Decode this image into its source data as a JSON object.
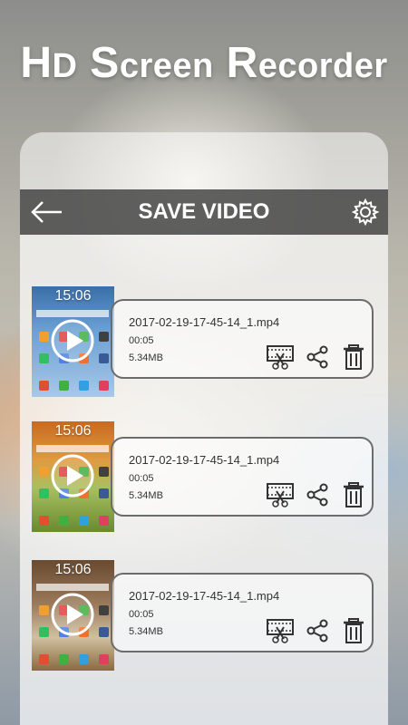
{
  "header": {
    "title_parts": [
      "H",
      "D",
      " S",
      "creen",
      " R",
      "ecorder"
    ]
  },
  "toolbar": {
    "title": "SAVE VIDEO"
  },
  "icons": {
    "back": "back-arrow-icon",
    "settings": "gear-icon",
    "cut": "film-scissors-icon",
    "share": "share-icon",
    "delete": "trash-icon",
    "play": "play-icon"
  },
  "videos": [
    {
      "filename": "2017-02-19-17-45-14_1.mp4",
      "duration": "00:05",
      "size": "5.34MB",
      "thumb_time": "15:06",
      "thumb_style": "blue"
    },
    {
      "filename": "2017-02-19-17-45-14_1.mp4",
      "duration": "00:05",
      "size": "5.34MB",
      "thumb_time": "15:06",
      "thumb_style": "orange"
    },
    {
      "filename": "2017-02-19-17-45-14_1.mp4",
      "duration": "00:05",
      "size": "5.34MB",
      "thumb_time": "15:06",
      "thumb_style": "brown"
    }
  ]
}
